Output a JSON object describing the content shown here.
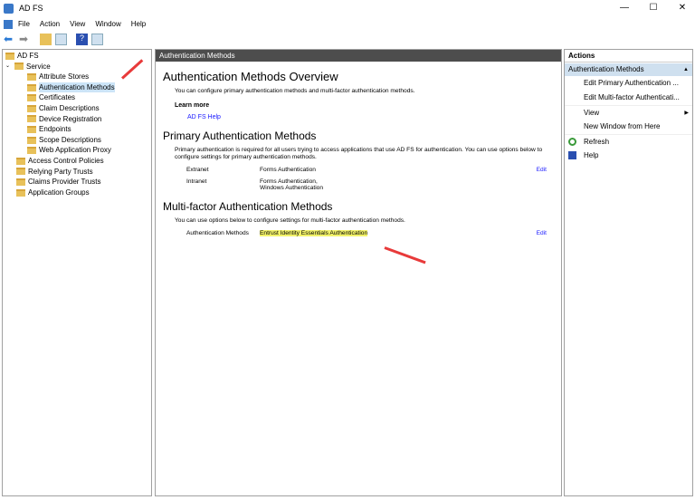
{
  "window": {
    "title": "AD FS",
    "minimize": "—",
    "maximize": "☐",
    "close": "✕"
  },
  "menu": [
    "File",
    "Action",
    "View",
    "Window",
    "Help"
  ],
  "tree": {
    "root": "AD FS",
    "service": "Service",
    "service_children": [
      "Attribute Stores",
      "Authentication Methods",
      "Certificates",
      "Claim Descriptions",
      "Device Registration",
      "Endpoints",
      "Scope Descriptions",
      "Web Application Proxy"
    ],
    "top_items": [
      "Access Control Policies",
      "Relying Party Trusts",
      "Claims Provider Trusts",
      "Application Groups"
    ]
  },
  "main": {
    "header": "Authentication Methods",
    "overview_title": "Authentication Methods Overview",
    "overview_text": "You can configure primary authentication methods and multi-factor authentication methods.",
    "learn_more": "Learn more",
    "help_link": "AD FS Help",
    "primary_title": "Primary Authentication Methods",
    "primary_text": "Primary authentication is required for all users trying to access applications that use AD FS for authentication. You can use options below to configure settings for primary authentication methods.",
    "extranet_label": "Extranet",
    "extranet_value": "Forms Authentication",
    "intranet_label": "Intranet",
    "intranet_value_1": "Forms Authentication,",
    "intranet_value_2": "Windows Authentication",
    "edit": "Edit",
    "mfa_title": "Multi-factor Authentication Methods",
    "mfa_text": "You can use options below to configure settings for multi-factor authentication methods.",
    "mfa_label": "Authentication Methods",
    "mfa_value": "Entrust Identity Essentials Authentication"
  },
  "actions": {
    "header": "Actions",
    "section": "Authentication Methods",
    "items": [
      "Edit Primary Authentication ...",
      "Edit Multi-factor Authenticati...",
      "View",
      "New Window from Here",
      "Refresh",
      "Help"
    ]
  },
  "colors": {
    "highlight": "#f3f36a",
    "arrow": "#e83a3a",
    "link": "#1a1aff"
  }
}
